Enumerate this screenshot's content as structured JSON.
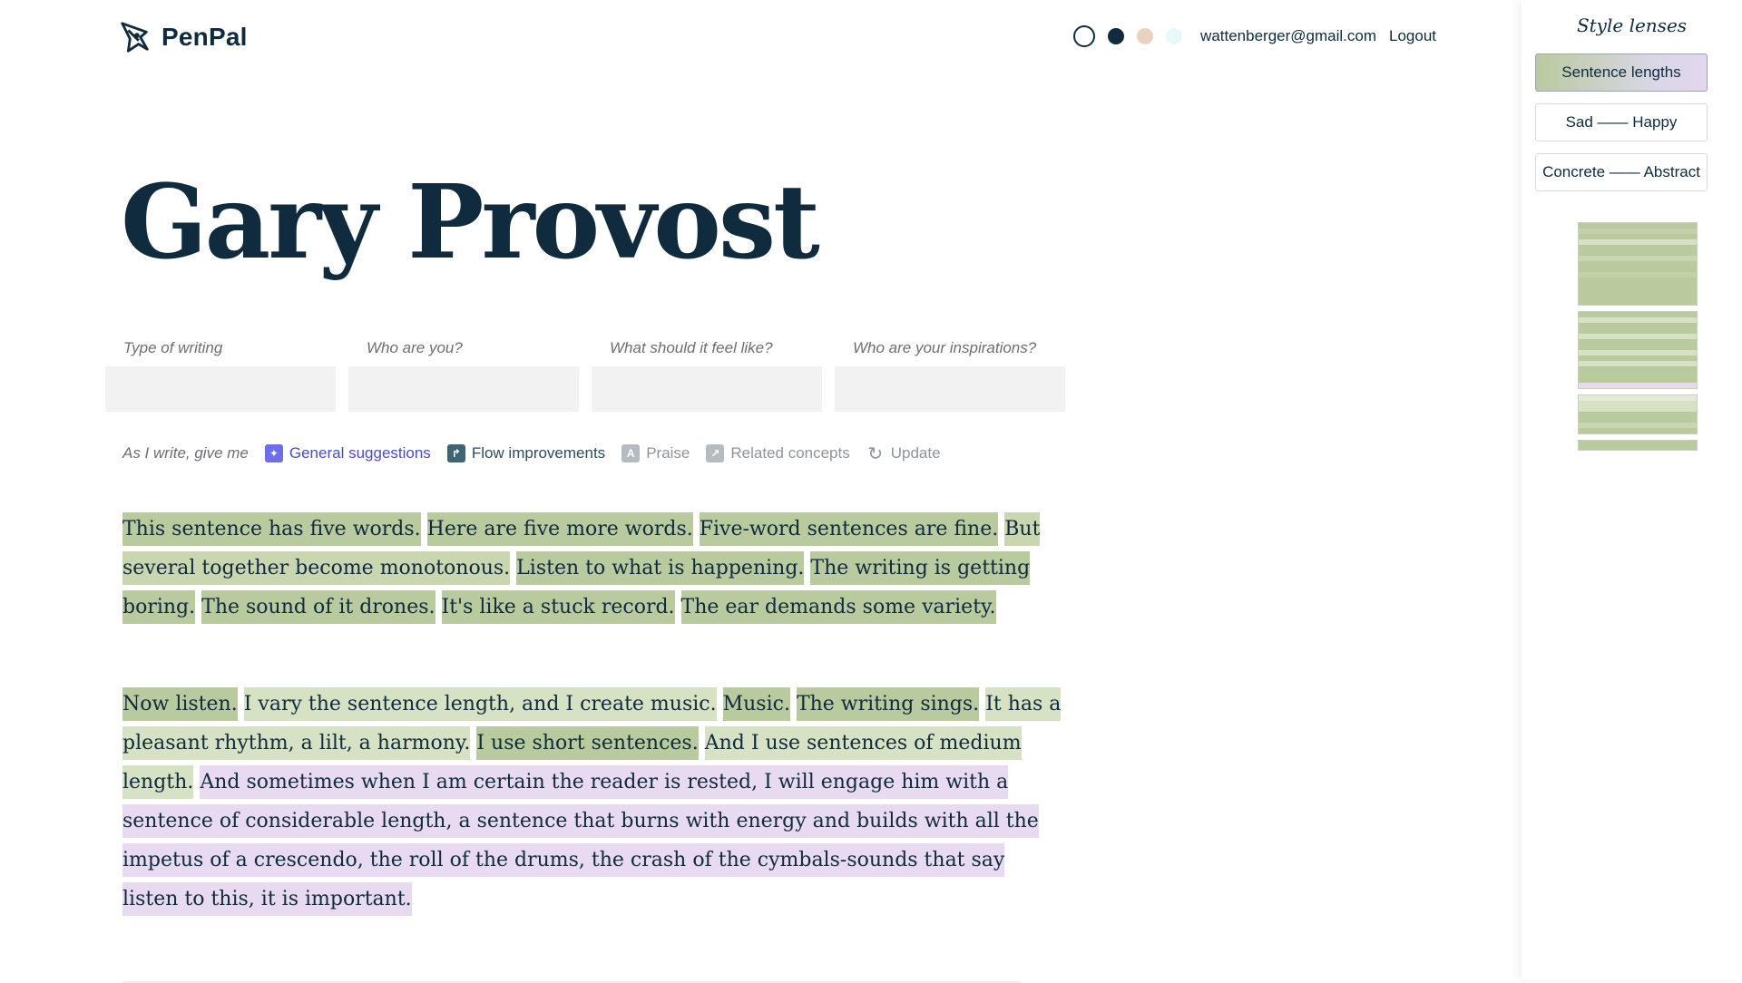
{
  "app": {
    "name": "PenPal"
  },
  "header": {
    "theme_swatches": [
      "white-outline-icon",
      "navy-dot-icon",
      "sand-dot-icon",
      "mint-dot-icon"
    ],
    "email": "wattenberger@gmail.com",
    "logout_label": "Logout"
  },
  "document": {
    "title": "Gary Provost"
  },
  "fields": [
    {
      "label": "Type of writing",
      "value": ""
    },
    {
      "label": "Who are you?",
      "value": ""
    },
    {
      "label": "What should it feel like?",
      "value": ""
    },
    {
      "label": "Who are your inspirations?",
      "value": ""
    }
  ],
  "suggestions": {
    "label": "As I write, give me",
    "options": [
      {
        "label": "General suggestions",
        "active": true
      },
      {
        "label": "Flow improvements",
        "active": true
      },
      {
        "label": "Praise",
        "active": false
      },
      {
        "label": "Related concepts",
        "active": false
      },
      {
        "label": "Update",
        "active": false
      }
    ]
  },
  "editor": {
    "p1": [
      "This sentence has five words.",
      "Here are five more words.",
      "Five-word sentences are fine.",
      "But several together become monotonous.",
      "Listen to what is happening.",
      "The writing is getting boring.",
      "The sound of it drones.",
      "It's like a stuck record.",
      "The ear demands some variety."
    ],
    "p2": [
      "Now listen.",
      "I vary the sentence length, and I create music.",
      "Music.",
      "The writing sings.",
      "It has a pleasant rhythm, a lilt, a harmony.",
      "I use short sentences.",
      "And I use sentences of medium length.",
      "And sometimes when I am certain the reader is rested, I will engage him with a sentence of considerable length, a sentence that burns with energy and builds with all the impetus of a crescendo, the roll of the drums, the crash of the cymbals-sounds that say listen to this, it is important."
    ]
  },
  "panel": {
    "title": "Style lenses",
    "lenses": [
      {
        "label": "Sentence lengths",
        "active": true
      },
      {
        "label": "Sad —— Happy",
        "active": false
      },
      {
        "label": "Concrete —— Abstract",
        "active": false
      }
    ]
  },
  "colors": {
    "ink": "#0f2b3d",
    "short_sentence": "#b9ca9f",
    "medium_sentence": "#d7e1c4",
    "long_sentence": "#e8daf0",
    "accent_general": "#6d6ee8"
  }
}
